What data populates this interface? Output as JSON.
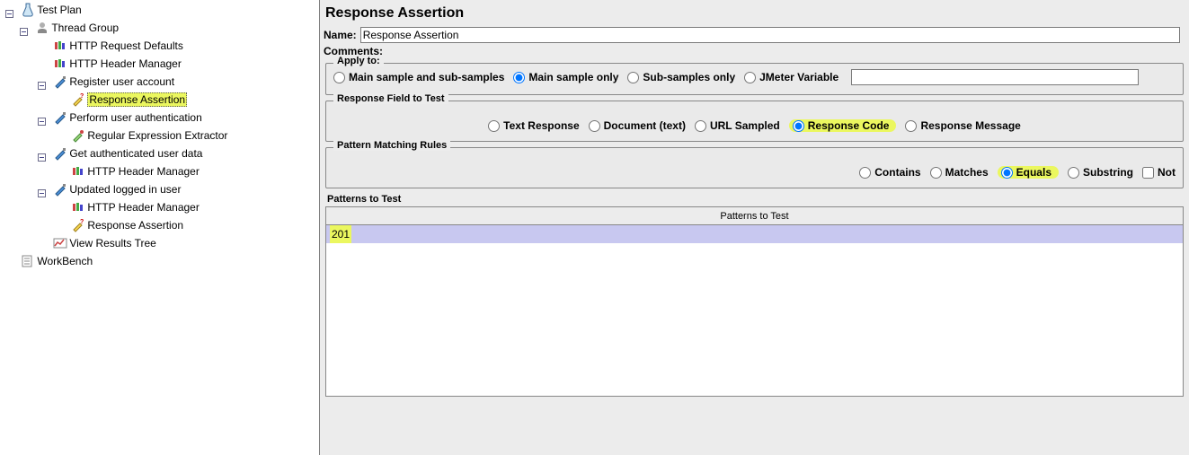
{
  "tree": {
    "testPlan": "Test Plan",
    "threadGroup": "Thread Group",
    "httpRequestDefaults": "HTTP Request Defaults",
    "httpHeaderManager": "HTTP Header Manager",
    "registerUser": "Register user account",
    "responseAssertion1": "Response Assertion",
    "performAuth": "Perform user authentication",
    "regexExtractor": "Regular Expression Extractor",
    "getAuthData": "Get authenticated user data",
    "httpHeaderManager2": "HTTP Header Manager",
    "updatedLogged": "Updated logged in user",
    "httpHeaderManager3": "HTTP Header Manager",
    "responseAssertion2": "Response Assertion",
    "viewResults": "View Results Tree",
    "workbench": "WorkBench"
  },
  "panel": {
    "title": "Response Assertion",
    "nameLabel": "Name:",
    "nameValue": "Response Assertion",
    "commentsLabel": "Comments:",
    "applyTo": {
      "title": "Apply to:",
      "opt1": "Main sample and sub-samples",
      "opt2": "Main sample only",
      "opt3": "Sub-samples only",
      "opt4": "JMeter Variable"
    },
    "respField": {
      "title": "Response Field to Test",
      "opt1": "Text Response",
      "opt2": "Document (text)",
      "opt3": "URL Sampled",
      "opt4": "Response Code",
      "opt5": "Response Message"
    },
    "matchRules": {
      "title": "Pattern Matching Rules",
      "opt1": "Contains",
      "opt2": "Matches",
      "opt3": "Equals",
      "opt4": "Substring",
      "not": "Not"
    },
    "patterns": {
      "sectionTitle": "Patterns to Test",
      "columnHeader": "Patterns to Test",
      "rows": [
        "201"
      ]
    }
  }
}
